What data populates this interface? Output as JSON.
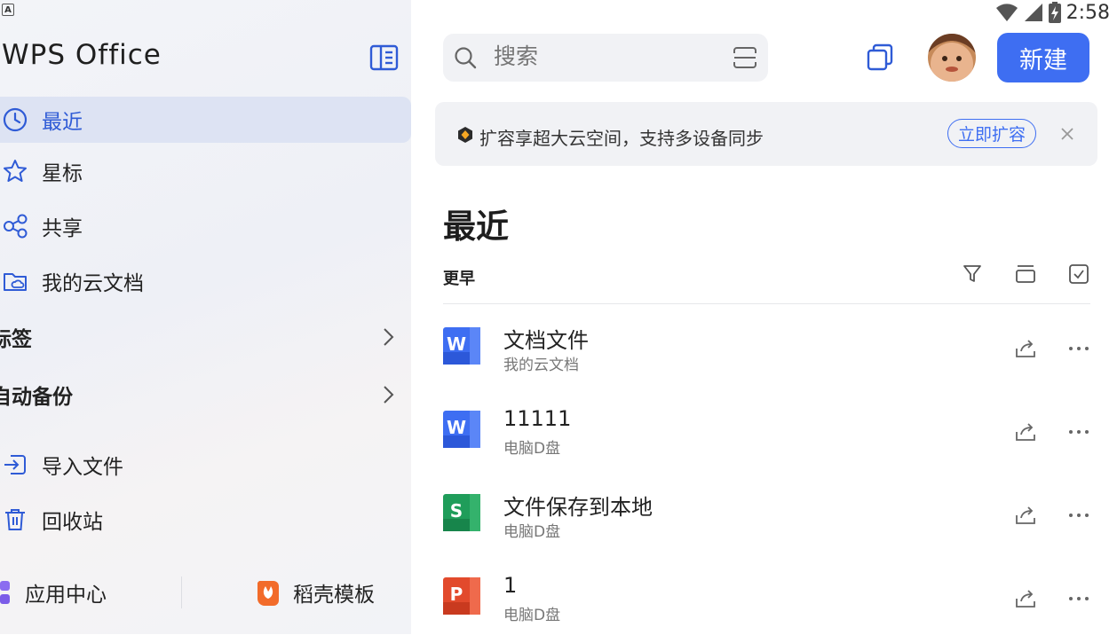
{
  "app": {
    "logo": "WPS Office",
    "status_indicator": "A"
  },
  "status_bar": {
    "time": "2:58"
  },
  "sidebar": {
    "nav": [
      {
        "label": "最近",
        "icon": "clock-icon",
        "active": true
      },
      {
        "label": "星标",
        "icon": "star-icon"
      },
      {
        "label": "共享",
        "icon": "share-nodes-icon"
      },
      {
        "label": "我的云文档",
        "icon": "cloud-folder-icon"
      }
    ],
    "sections": [
      {
        "label": "标签"
      },
      {
        "label": "自动备份"
      }
    ],
    "tools": [
      {
        "label": "导入文件",
        "icon": "import-icon"
      },
      {
        "label": "回收站",
        "icon": "trash-icon"
      }
    ],
    "bottom": {
      "app_center": "应用中心",
      "templates": "稻壳模板"
    }
  },
  "header": {
    "search_placeholder": "搜索",
    "new_button": "新建"
  },
  "promo": {
    "text": "扩容享超大云空间，支持多设备同步",
    "button": "立即扩容"
  },
  "main": {
    "title": "最近",
    "group": "更早",
    "files": [
      {
        "name": "文档文件",
        "location": "我的云文档",
        "type": "word",
        "icon_letter": "W",
        "color": "#3e6ef2"
      },
      {
        "name": "11111",
        "location": "电脑D盘",
        "type": "word",
        "icon_letter": "W",
        "color": "#3e6ef2"
      },
      {
        "name": "文件保存到本地",
        "location": "电脑D盘",
        "type": "sheet",
        "icon_letter": "S",
        "color": "#1f9d5a"
      },
      {
        "name": "1",
        "location": "电脑D盘",
        "type": "ppt",
        "icon_letter": "P",
        "color": "#e24a2c"
      }
    ]
  },
  "colors": {
    "accent": "#3e6ef2",
    "active_bg": "#dde3f3"
  }
}
